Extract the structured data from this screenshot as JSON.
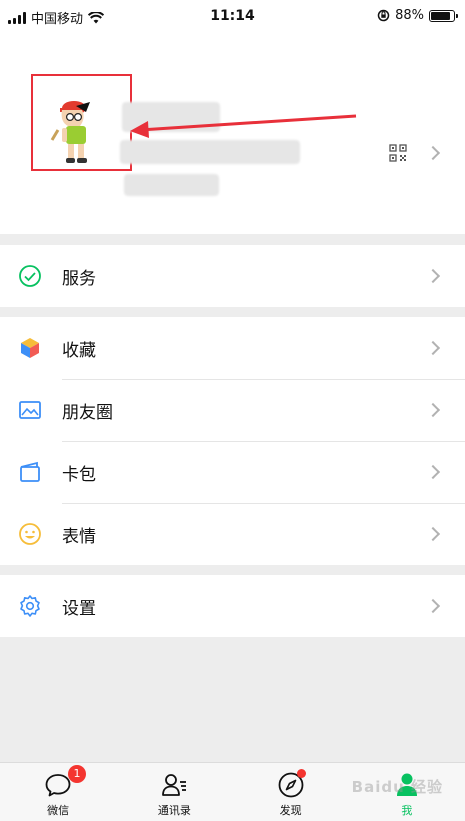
{
  "status_bar": {
    "carrier": "中国移动",
    "time": "11:14",
    "battery": "88%",
    "battery_level": 0.88
  },
  "profile": {
    "avatar_icon": "cartoon-boy-avatar",
    "qr_icon": "qr-code-icon",
    "highlight_color": "#e8303a"
  },
  "menu": {
    "services": {
      "label": "服务",
      "icon": "wallet-check-icon"
    },
    "favorites": {
      "label": "收藏",
      "icon": "cube-icon"
    },
    "moments": {
      "label": "朋友圈",
      "icon": "picture-icon"
    },
    "cards": {
      "label": "卡包",
      "icon": "card-wallet-icon"
    },
    "stickers": {
      "label": "表情",
      "icon": "smiley-icon"
    },
    "settings": {
      "label": "设置",
      "icon": "gear-icon"
    }
  },
  "tabbar": {
    "chats": {
      "label": "微信",
      "badge": "1"
    },
    "contacts": {
      "label": "通讯录"
    },
    "discover": {
      "label": "发现"
    },
    "me": {
      "label": "我"
    }
  },
  "watermark": "Baidu 经验",
  "colors": {
    "accent": "#07c160",
    "badge": "#f43530"
  }
}
